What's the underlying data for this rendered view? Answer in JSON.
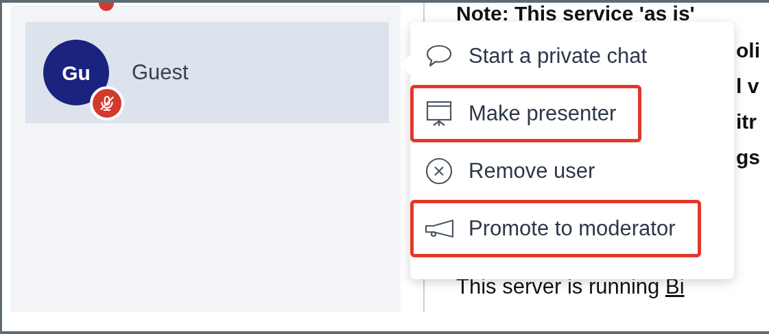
{
  "participants": [
    {
      "initials": "Gu",
      "name": "Guest",
      "selected": true,
      "muted": true
    }
  ],
  "context_menu": {
    "items": [
      {
        "kind": "chat",
        "label": "Start a private chat",
        "highlighted": false
      },
      {
        "kind": "presenter",
        "label": "Make presenter",
        "highlighted": true
      },
      {
        "kind": "remove",
        "label": "Remove user",
        "highlighted": false
      },
      {
        "kind": "promote",
        "label": "Promote to moderator",
        "highlighted": true
      }
    ]
  },
  "content": {
    "note": "Note: This service 'as is'",
    "fragments": [
      "oli",
      "l v",
      "itr",
      "gs"
    ],
    "footer_text": "This server is running ",
    "footer_link": "Bi"
  }
}
